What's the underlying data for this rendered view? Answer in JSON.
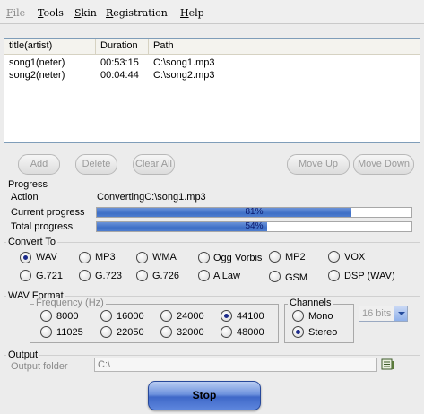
{
  "menu": [
    {
      "label": "File",
      "mn": "F",
      "rest": "ile",
      "disabled": true
    },
    {
      "label": "Tools",
      "mn": "T",
      "rest": "ools",
      "disabled": false
    },
    {
      "label": "Skin",
      "mn": "S",
      "rest": "kin",
      "disabled": false
    },
    {
      "label": "Registration",
      "mn": "R",
      "rest": "egistration",
      "disabled": false
    },
    {
      "label": "Help",
      "mn": "H",
      "rest": "elp",
      "disabled": false
    }
  ],
  "table": {
    "columns": [
      "title(artist)",
      "Duration",
      "Path"
    ],
    "rows": [
      [
        "song1(neter)",
        "00:53:15",
        "C:\\song1.mp3"
      ],
      [
        "song2(neter)",
        "00:04:44",
        "C:\\song2.mp3"
      ]
    ]
  },
  "buttons": {
    "add": "Add",
    "delete": "Delete",
    "clear_all": "Clear All",
    "move_up": "Move Up",
    "move_down": "Move Down"
  },
  "progress": {
    "group_label": "Progress",
    "action_label": "Action",
    "action_value": "ConvertingC:\\song1.mp3",
    "current_label": "Current progress",
    "current_text": "81%",
    "current_fraction": 0.81,
    "total_label": "Total progress",
    "total_text": "54%",
    "total_fraction": 0.54
  },
  "convert_to": {
    "group_label": "Convert To",
    "options": [
      "WAV",
      "MP3",
      "WMA",
      "Ogg Vorbis",
      "MP2",
      "VOX",
      "G.721",
      "G.723",
      "G.726",
      "A Law",
      "GSM",
      "DSP (WAV)"
    ],
    "selected": "WAV"
  },
  "wav_format": {
    "group_label": "WAV Format",
    "frequency_label": "Frequency (Hz)",
    "frequencies": [
      "8000",
      "16000",
      "24000",
      "44100",
      "11025",
      "22050",
      "32000",
      "48000"
    ],
    "frequency_selected": "44100",
    "channels_label": "Channels",
    "channels": [
      "Mono",
      "Stereo"
    ],
    "channel_selected": "Stereo",
    "bits_value": "16 bits"
  },
  "output": {
    "group_label": "Output",
    "folder_label": "Output folder",
    "folder_value": "C:\\"
  },
  "stop_label": "Stop"
}
